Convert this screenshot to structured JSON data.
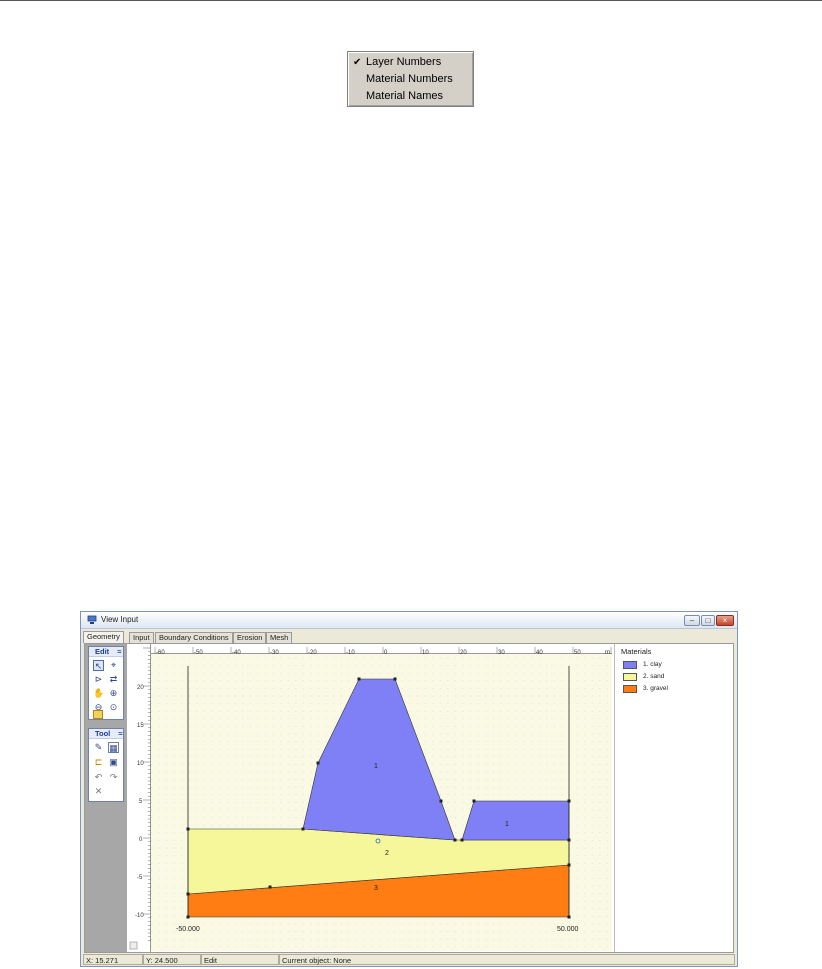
{
  "context_menu": {
    "items": [
      {
        "label": "Layer Numbers",
        "checked": true
      },
      {
        "label": "Material Numbers",
        "checked": false
      },
      {
        "label": "Material Names",
        "checked": false
      }
    ],
    "check_glyph": "✔"
  },
  "window": {
    "title": "View Input",
    "controls": {
      "minimize": "–",
      "maximize": "□",
      "close": "×"
    },
    "tabs": [
      "Geometry",
      "Input",
      "Boundary Conditions",
      "Erosion",
      "Mesh"
    ],
    "active_tab": "Geometry"
  },
  "toolbox": {
    "edit_label": "Edit",
    "tool_label": "Tool",
    "collapse_glyph": "≈",
    "edit_icons": [
      "select-pointer-icon",
      "edit-point-icon",
      "draw-line-icon",
      "move-points-icon",
      "pan-icon",
      "zoom-in-icon",
      "zoom-out-icon",
      "zoom-limits-icon",
      "material-icon"
    ],
    "tool_icons": [
      "pencil-icon",
      "grid-icon",
      "ruler-icon",
      "picture-icon",
      "undo-icon",
      "redo-icon",
      "delete-icon"
    ]
  },
  "ruler": {
    "x_ticks": [
      "-60",
      "-50",
      "-40",
      "-30",
      "-20",
      "-10",
      "0",
      "10",
      "20",
      "30",
      "40",
      "50"
    ],
    "x_unit": "m",
    "y_ticks": [
      "20",
      "15",
      "10",
      "5",
      "0",
      "-5",
      "-10"
    ]
  },
  "drawing": {
    "colors": {
      "clay": "#8080f6",
      "sand": "#f6f69a",
      "gravel": "#ff7d12",
      "canvas": "#fafae4",
      "grid": "#c8c8c8"
    },
    "layer_labels": [
      "1",
      "1",
      "2",
      "3"
    ],
    "left_limit_label": "-50.000",
    "right_limit_label": "50.000"
  },
  "legend": {
    "title": "Materials",
    "items": [
      {
        "label": "1. clay",
        "color": "#8080f6"
      },
      {
        "label": "2. sand",
        "color": "#f6f69a"
      },
      {
        "label": "3. gravel",
        "color": "#ff7d12"
      }
    ]
  },
  "status": {
    "x": "X: 15.271",
    "y": "Y: 24.500",
    "mode": "Edit",
    "current_object": "Current object: None"
  }
}
